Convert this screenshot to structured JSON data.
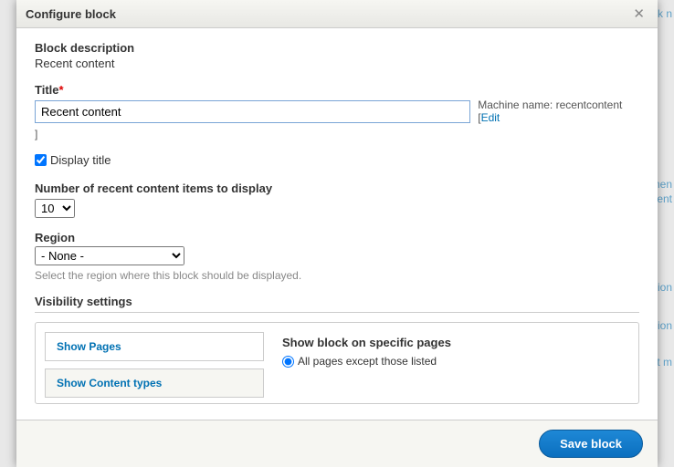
{
  "dialog": {
    "title": "Configure block"
  },
  "block_description": {
    "label": "Block description",
    "value": "Recent content"
  },
  "title_field": {
    "label": "Title",
    "value": "Recent content",
    "machine_name_label": "Machine name:",
    "machine_name_value": "recentcontent",
    "edit_link": "Edit",
    "stray_bracket": "]"
  },
  "display_title": {
    "label": "Display title",
    "checked": true
  },
  "num_items": {
    "label": "Number of recent content items to display",
    "value": "10"
  },
  "region": {
    "label": "Region",
    "value": "- None -",
    "help": "Select the region where this block should be displayed."
  },
  "visibility": {
    "heading": "Visibility settings",
    "tab_pages": "Show Pages",
    "tab_content_types": "Show Content types",
    "pages_heading": "Show block on specific pages",
    "radio_all_except": "All pages except those listed"
  },
  "save_button": "Save block",
  "bg": {
    "filter": "Filter by block n",
    "men": "men",
    "ent": "ent",
    "ion1": "ion",
    "ion2": "ion",
    "tm": "t m"
  }
}
